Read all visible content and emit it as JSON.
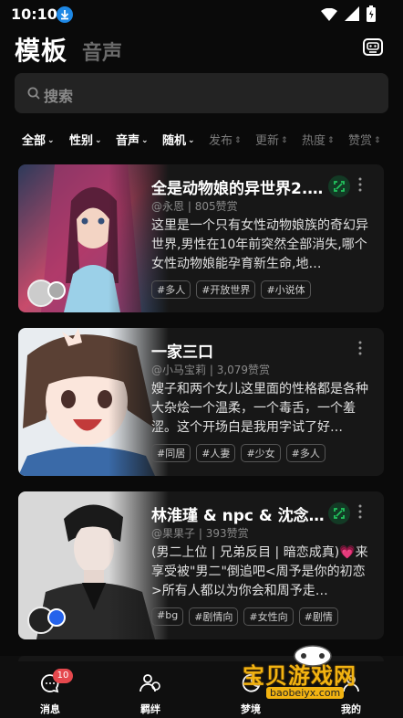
{
  "status_bar": {
    "time": "10:10"
  },
  "header": {
    "active_tab": "模板",
    "inactive_tab": "音声"
  },
  "search": {
    "placeholder": "搜索"
  },
  "filters": [
    {
      "label": "全部",
      "caret": true,
      "active": true
    },
    {
      "label": "性别",
      "caret": true,
      "active": true
    },
    {
      "label": "音声",
      "caret": true,
      "active": true
    },
    {
      "label": "随机",
      "caret": true,
      "active": true
    },
    {
      "label": "发布",
      "caret": true,
      "active": false
    },
    {
      "label": "更新",
      "caret": true,
      "active": false
    },
    {
      "label": "热度",
      "caret": true,
      "active": false
    },
    {
      "label": "赞赏",
      "caret": true,
      "active": false
    }
  ],
  "cards": [
    {
      "title": "全是动物娘的异世界2.…",
      "author": "@永恩",
      "likes": "805赞赏",
      "desc": "这里是一个只有女性动物娘族的奇幻异世界,男性在10年前突然全部消失,哪个女性动物娘能孕育新生命,地…",
      "tags": [
        "#多人",
        "#开放世界",
        "#小说体"
      ],
      "has_share": true,
      "has_avatar": true
    },
    {
      "title": "一家三口",
      "author": "@小马宝莉",
      "likes": "3,079赞赏",
      "desc": "嫂子和两个女儿这里面的性格都是各种大杂烩一个温柔，一个毒舌，一个羞涩。这个开场白是我用字试了好…",
      "tags": [
        "#同居",
        "#人妻",
        "#少女",
        "#多人"
      ],
      "has_share": false,
      "has_avatar": false
    },
    {
      "title": "林淮瑾 & npc & 沈念…",
      "author": "@果果子",
      "likes": "393赞赏",
      "desc": "(男二上位 | 兄弟反目 | 暗恋成真)💗来享受被\"男二\"倒追吧<周予是你的初恋>所有人都以为你会和周予走…",
      "tags": [
        "#bg",
        "#剧情向",
        "#女性向",
        "#剧情"
      ],
      "has_share": true,
      "has_avatar": true
    }
  ],
  "bottom_nav": {
    "messages": {
      "label": "消息",
      "badge": "10"
    },
    "bonds": {
      "label": "羁绊"
    },
    "dream": {
      "label": "梦境"
    },
    "mine": {
      "label": "我的"
    }
  },
  "watermark": {
    "text": "宝贝游戏网",
    "url": "baobeiyx.com"
  },
  "colors": {
    "background": "#0a0a0a",
    "card": "#171717",
    "badge": "#e5484d",
    "share": "#22c55e"
  }
}
